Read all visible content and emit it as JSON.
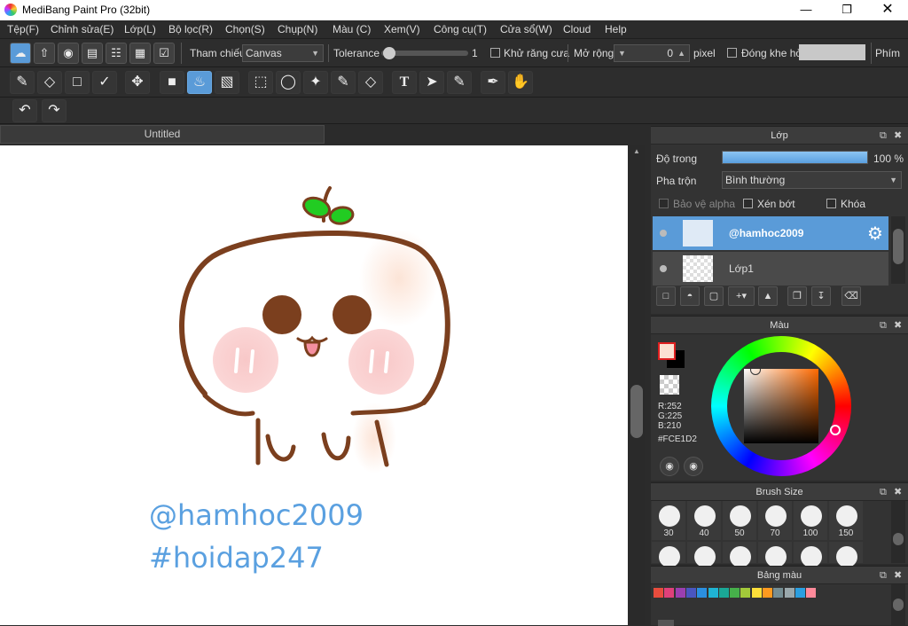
{
  "window": {
    "title": "MediBang Paint Pro (32bit)"
  },
  "menu": [
    "Tệp(F)",
    "Chỉnh sửa(E)",
    "Lớp(L)",
    "Bộ lọc(R)",
    "Chọn(S)",
    "Chụp(N)",
    "Màu (C)",
    "Xem(V)",
    "Công cụ(T)",
    "Cửa sổ(W)",
    "Cloud",
    "Help"
  ],
  "toolbar": {
    "reference_label": "Tham chiếu",
    "reference_value": "Canvas",
    "tolerance_label": "Tolerance",
    "tolerance_value": "1",
    "tolerance_level": 0.02,
    "antialias_label": "Khử răng cưa",
    "expand_label": "Mở rộng",
    "expand_value": "0",
    "expand_unit": "pixel",
    "close_gap_label": "Đóng khe hở",
    "keys_label": "Phím"
  },
  "document": {
    "tab_title": "Untitled",
    "watermark_line1": "@hamhoc2009",
    "watermark_line2": "#hoidap247"
  },
  "layers_panel": {
    "title": "Lớp",
    "opacity_label": "Độ trong",
    "opacity_value": "100 %",
    "opacity_level": 1.0,
    "blend_label": "Pha trộn",
    "blend_value": "Bình thường",
    "protect_alpha_label": "Bảo vệ alpha",
    "clipping_label": "Xén bớt",
    "lock_label": "Khóa",
    "layers": [
      {
        "name": "@hamhoc2009",
        "selected": true
      },
      {
        "name": "Lớp1",
        "selected": false
      }
    ]
  },
  "color_panel": {
    "title": "Màu",
    "r": "R:252",
    "g": "G:225",
    "b": "B:210",
    "hex": "#FCE1D2",
    "foreground_color": "#FCE1D2"
  },
  "brush_size_panel": {
    "title": "Brush Size",
    "sizes": [
      "30",
      "40",
      "50",
      "70",
      "100",
      "150"
    ]
  },
  "palette_panel": {
    "title": "Bảng màu",
    "swatches": [
      "#e84c3d",
      "#e0407a",
      "#9b3fb0",
      "#4a56c0",
      "#2b8fe0",
      "#1fb4d4",
      "#1aa896",
      "#46b04a",
      "#a2c93a",
      "#ffe03a",
      "#ff9a1f",
      "#758e94",
      "#9aa8ac",
      "#2b9fe0",
      "#ff8a9a"
    ]
  }
}
